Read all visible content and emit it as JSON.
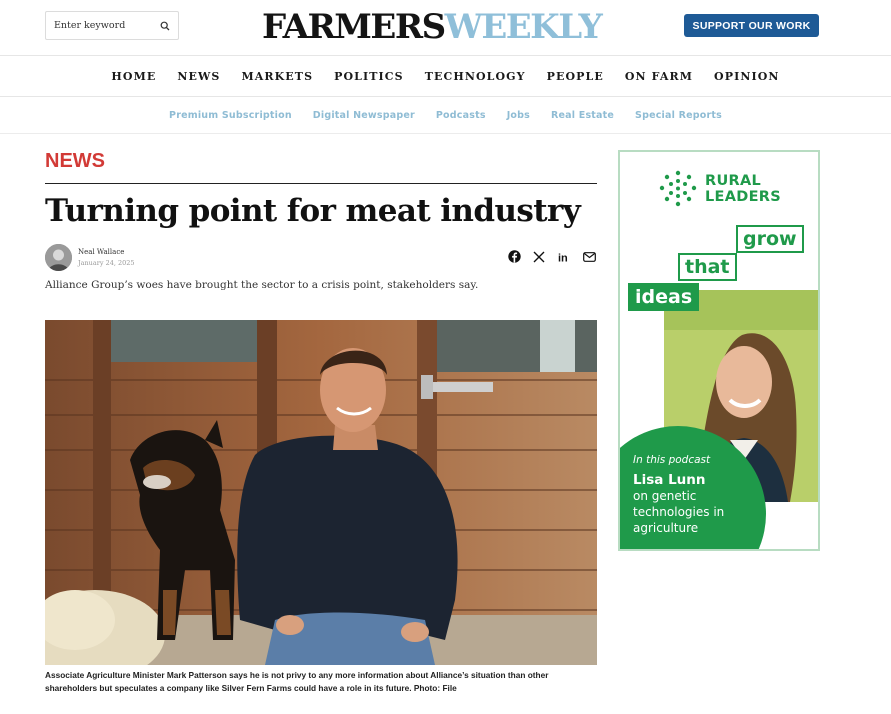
{
  "header": {
    "search": {
      "placeholder": "Enter keyword",
      "icon": "search-icon"
    },
    "logo": {
      "part1": "FARMERS",
      "part2": "WEEKLY"
    },
    "support_label": "SUPPORT OUR WORK",
    "colors": {
      "brand_blue": "#1e5a96",
      "logo_light": "#8fbfd9",
      "logo_dark": "#141414"
    }
  },
  "main_nav": {
    "items": [
      "HOME",
      "NEWS",
      "MARKETS",
      "POLITICS",
      "TECHNOLOGY",
      "PEOPLE",
      "ON FARM",
      "OPINION"
    ]
  },
  "sub_nav": {
    "items": [
      "Premium Subscription",
      "Digital Newspaper",
      "Podcasts",
      "Jobs",
      "Real Estate",
      "Special Reports"
    ],
    "color": "#8fbcd4"
  },
  "article": {
    "section": "NEWS",
    "section_color": "#d23a36",
    "headline": "Turning point for meat industry",
    "author": "Neal Wallace",
    "date": "January 24, 2025",
    "share_icons": [
      "facebook-icon",
      "x-icon",
      "linkedin-icon",
      "email-icon"
    ],
    "standfirst": "Alliance Group’s woes have brought the sector to a crisis point, stakeholders say.",
    "caption_lines": [
      "Associate Agriculture Minister Mark Patterson says he is not privy to any more information about Alliance’s situation than other",
      "shareholders but speculates a company like Silver Fern Farms could have a role in its future. Photo: File"
    ]
  },
  "ad": {
    "logo_line1": "RURAL",
    "logo_line2": "LEADERS",
    "words": [
      "grow",
      "that",
      "ideas"
    ],
    "podcast_intro": "In this podcast",
    "guest": "Lisa Lunn",
    "topic_lines": [
      "on genetic",
      "technologies in",
      "agriculture"
    ],
    "accent_color": "#1f9a4a"
  }
}
